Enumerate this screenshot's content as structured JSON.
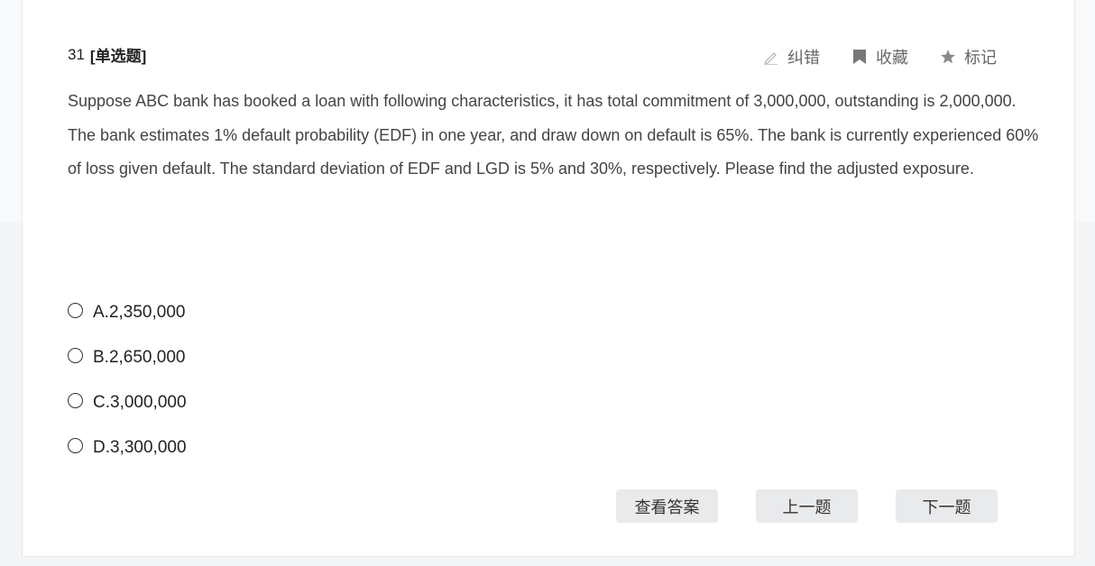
{
  "question": {
    "number": "31",
    "type": "[单选题]",
    "text": "Suppose ABC bank has booked a loan with following characteristics, it has total commitment of 3,000,000, outstanding is 2,000,000. The bank estimates 1% default probability (EDF) in one year, and draw down on default is 65%. The bank is currently experienced 60% of loss given default. The standard deviation of EDF and LGD is 5% and 30%, respectively. Please find the adjusted exposure."
  },
  "toolbar": {
    "correct_label": "纠错",
    "correct_icon": "pencil-icon",
    "favorite_label": "收藏",
    "favorite_icon": "bookmark-icon",
    "mark_label": "标记",
    "mark_icon": "star-icon"
  },
  "options": [
    {
      "label": "A.2,350,000"
    },
    {
      "label": "B.2,650,000"
    },
    {
      "label": "C.3,000,000"
    },
    {
      "label": "D.3,300,000"
    }
  ],
  "buttons": {
    "view_answer": "查看答案",
    "prev": "上一题",
    "next": "下一题"
  },
  "colors": {
    "button_bg": "#e9eaec",
    "icon_gray": "#888888"
  }
}
